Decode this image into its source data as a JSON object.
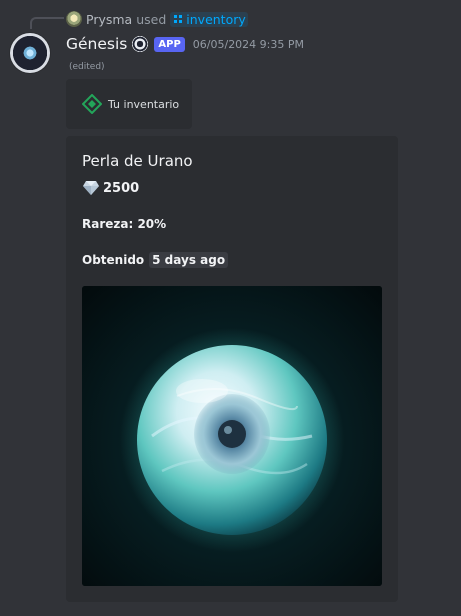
{
  "reply": {
    "user": "Prysma",
    "action": "used",
    "command": "inventory"
  },
  "message": {
    "author": "Génesis",
    "app_tag": "APP",
    "timestamp": "06/05/2024 9:35 PM",
    "edited": "(edited)"
  },
  "inventory_button": {
    "label": "Tu inventario",
    "icon": "diamond-icon"
  },
  "embed": {
    "title": "Perla de Urano",
    "value_icon": "gem-icon",
    "value": "2500",
    "rarity": "Rareza: 20%",
    "obtained_label": "Obtenido",
    "obtained_time": "5 days ago",
    "image": "glowing-pearl-orb"
  },
  "colors": {
    "background": "#313338",
    "embed_background": "#2b2d31",
    "app_tag": "#5865f2",
    "command_link": "#00a8fc",
    "button_icon": "#23a55a"
  }
}
